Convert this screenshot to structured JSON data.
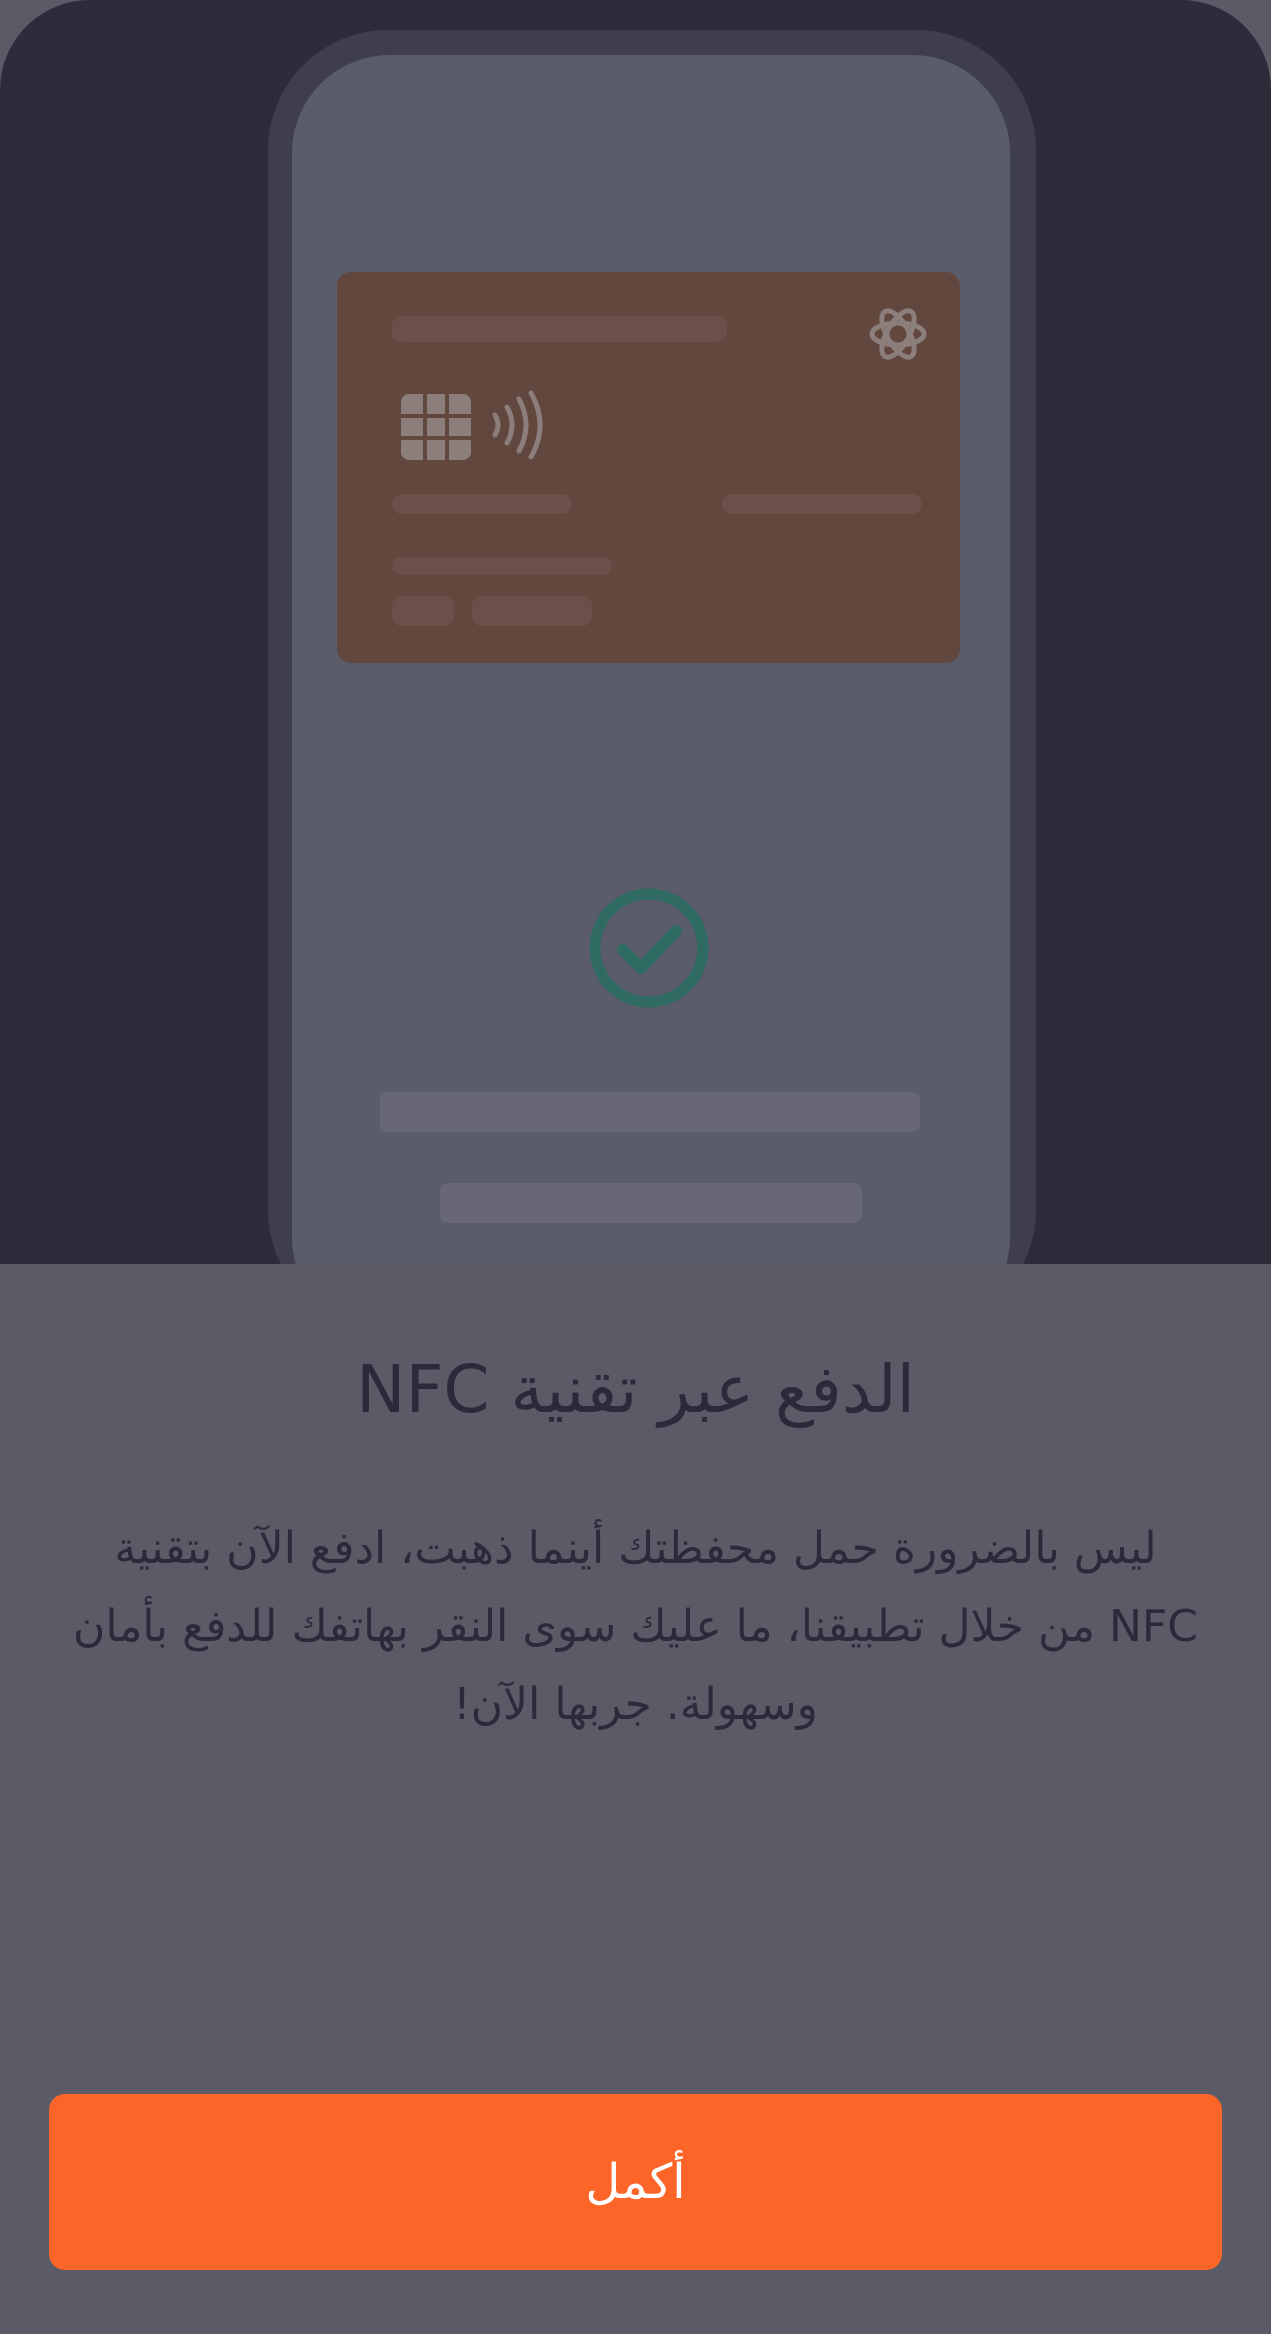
{
  "onboarding": {
    "title": "الدفع عبر تقنية NFC",
    "description": "ليس بالضرورة حمل محفظتك أينما ذهبت، ادفع الآن بتقنية NFC من خلال تطبيقنا، ما عليك سوى النقر بهاتفك للدفع بأمان وسهولة. جربها الآن!",
    "continue_label": "أكمل"
  },
  "illustration": {
    "card_color": "#62473e",
    "check_color": "#2f6b62"
  },
  "colors": {
    "accent": "#fc6428",
    "sheet_background": "#5b5b68",
    "hero_background": "#2d2c3a",
    "text": "#2b2a38"
  }
}
